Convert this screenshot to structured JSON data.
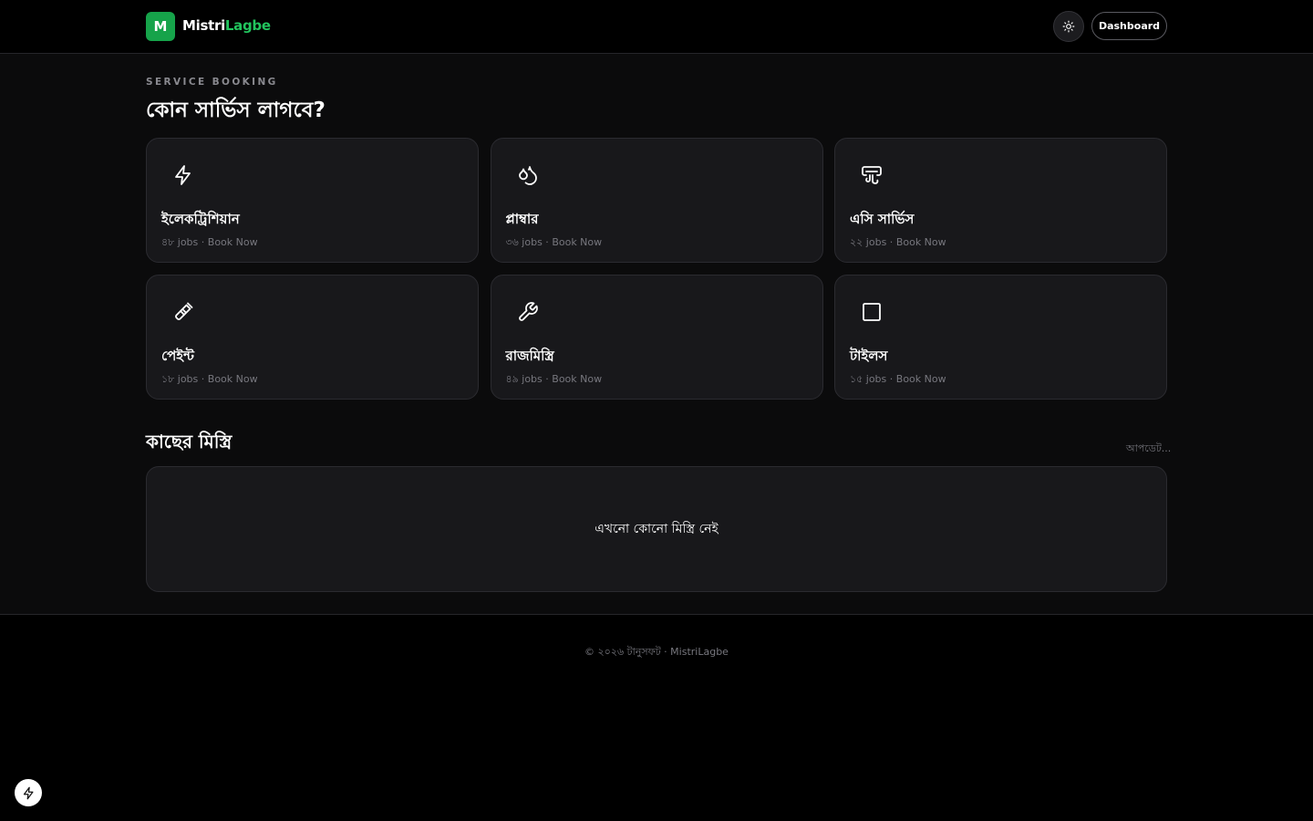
{
  "header": {
    "logo_letter": "M",
    "brand_part1": "Mistri",
    "brand_part2": "Lagbe",
    "theme_toggle_icon": "sun-icon",
    "dashboard_label": "Dashboard"
  },
  "hero": {
    "eyebrow": "SERVICE BOOKING",
    "title": "কোন সার্ভিস লাগবে?"
  },
  "services": [
    {
      "icon": "bolt-icon",
      "title": "ইলেকট্রিশিয়ান",
      "jobs": "৪৮ jobs",
      "action": "Book Now"
    },
    {
      "icon": "droplets-icon",
      "title": "প্লাম্বার",
      "jobs": "৩৬ jobs",
      "action": "Book Now"
    },
    {
      "icon": "air-vent-icon",
      "title": "এসি সার্ভিস",
      "jobs": "২২ jobs",
      "action": "Book Now"
    },
    {
      "icon": "paintbrush-icon",
      "title": "পেইন্ট",
      "jobs": "১৮ jobs",
      "action": "Book Now"
    },
    {
      "icon": "wrench-icon",
      "title": "রাজমিস্ত্রি",
      "jobs": "৪৯ jobs",
      "action": "Book Now"
    },
    {
      "icon": "square-icon",
      "title": "টাইলস",
      "jobs": "১৫ jobs",
      "action": "Book Now"
    }
  ],
  "nearby": {
    "title": "কাছের মিস্ত্রি",
    "status": "আপডেট...",
    "empty_message": "এখনো কোনো মিস্ত্রি নেই"
  },
  "footer": {
    "text": "© ২০২৬ টানুসফট · MistriLagbe"
  },
  "fab_icon": "bolt-icon",
  "colors": {
    "accent": "#16a34a",
    "brand_green": "#22c55e",
    "card_bg": "#18181b"
  }
}
